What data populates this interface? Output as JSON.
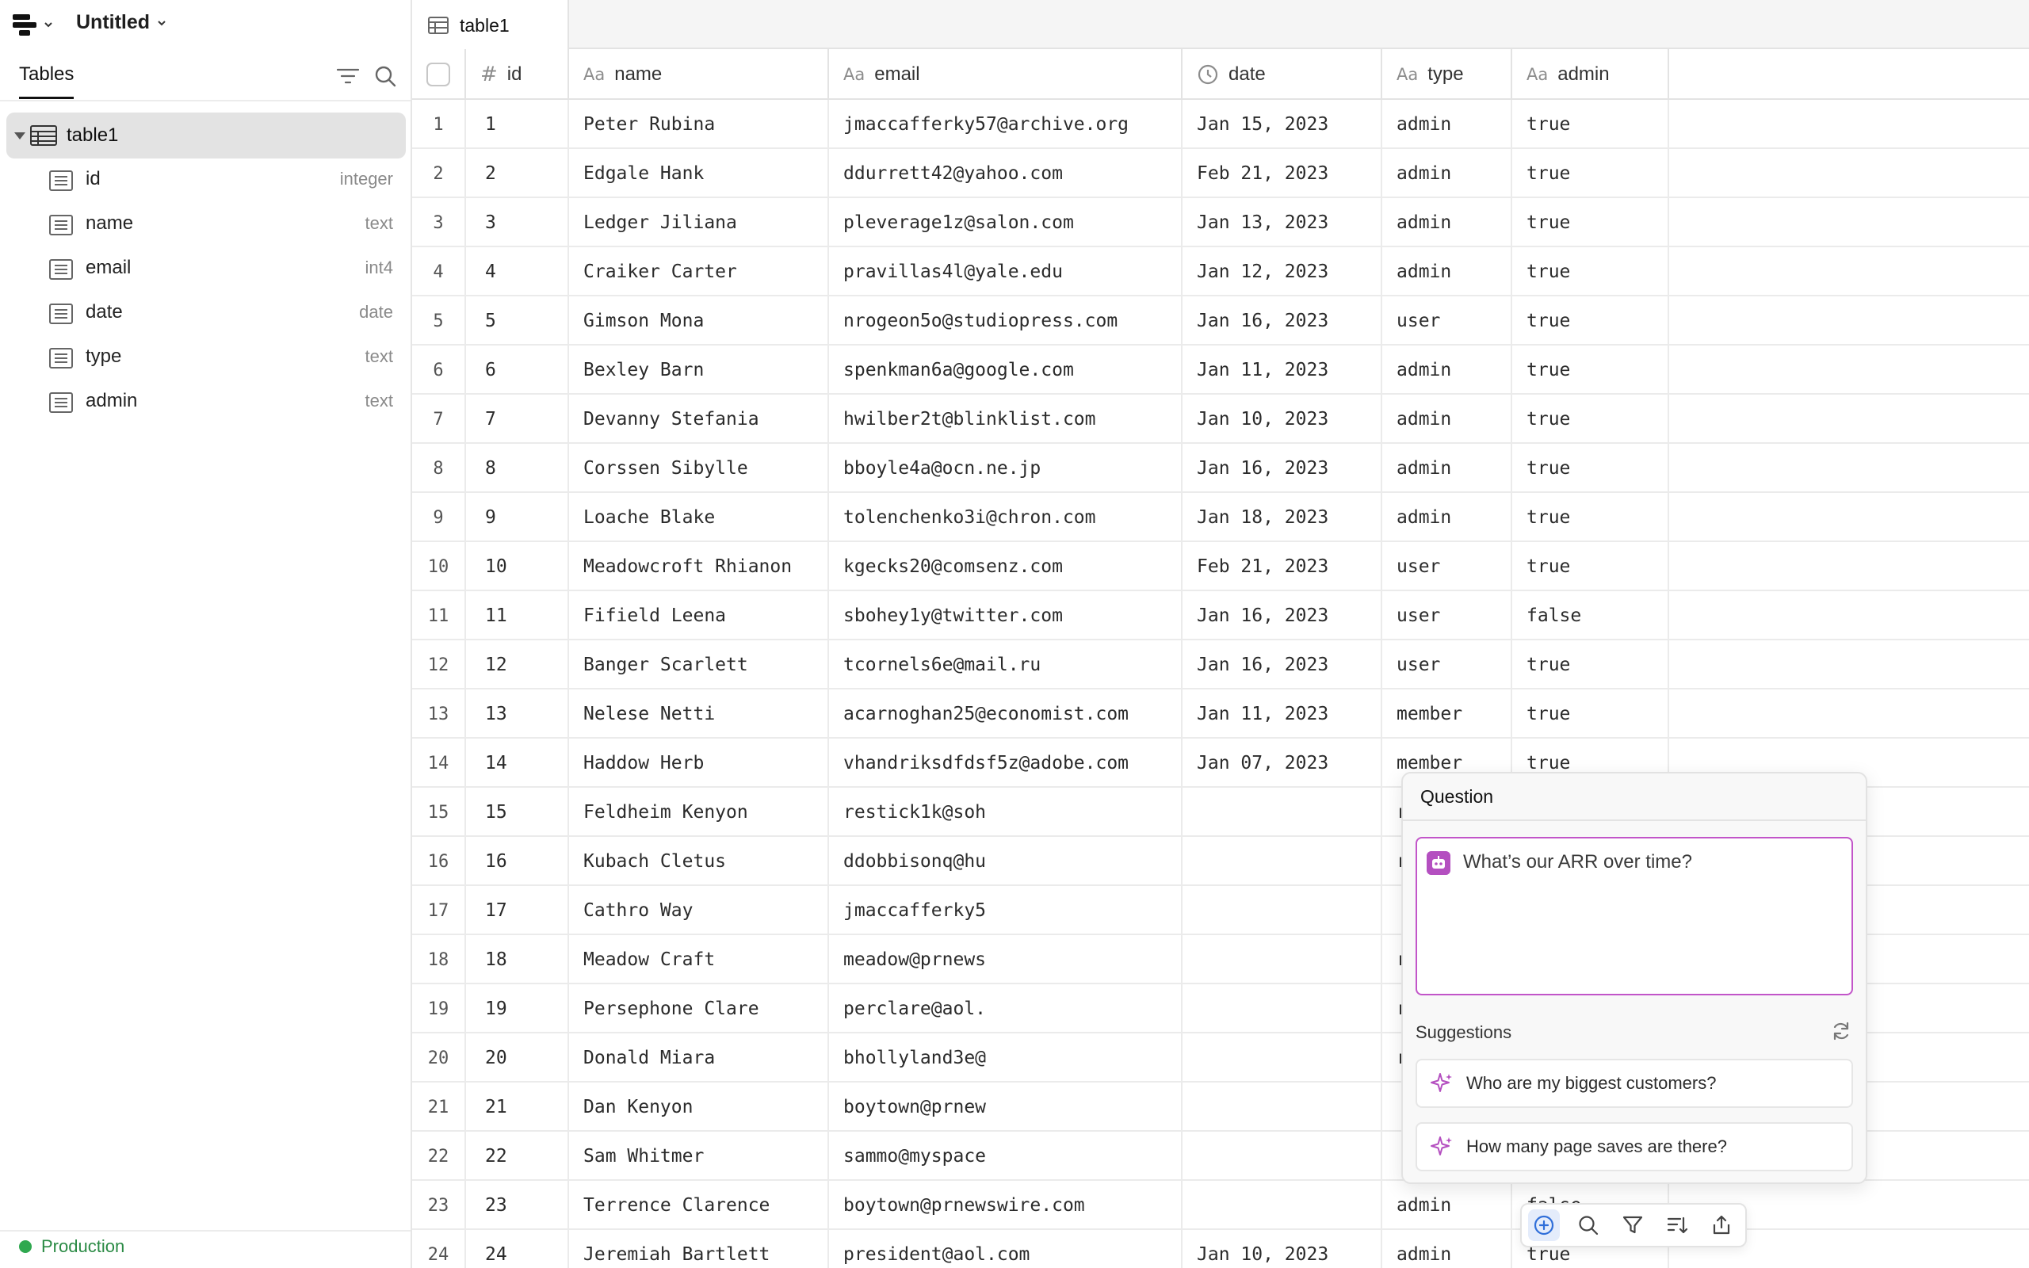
{
  "app": {
    "doc_title": "Untitled",
    "environment": "Production"
  },
  "sidebar": {
    "tab": "Tables",
    "table": {
      "name": "table1"
    },
    "fields": [
      {
        "name": "id",
        "type": "integer"
      },
      {
        "name": "name",
        "type": "text"
      },
      {
        "name": "email",
        "type": "int4"
      },
      {
        "name": "date",
        "type": "date"
      },
      {
        "name": "type",
        "type": "text"
      },
      {
        "name": "admin",
        "type": "text"
      }
    ]
  },
  "main": {
    "tab": "table1",
    "columns": [
      {
        "key": "id",
        "label": "id",
        "icon": "#"
      },
      {
        "key": "name",
        "label": "name",
        "icon": "Aa"
      },
      {
        "key": "email",
        "label": "email",
        "icon": "Aa"
      },
      {
        "key": "date",
        "label": "date",
        "icon": "clock"
      },
      {
        "key": "type",
        "label": "type",
        "icon": "Aa"
      },
      {
        "key": "admin",
        "label": "admin",
        "icon": "Aa"
      }
    ],
    "rows": [
      {
        "n": "1",
        "id": "1",
        "name": "Peter Rubina",
        "email": "jmaccafferky57@archive.org",
        "date": "Jan 15, 2023",
        "type": "admin",
        "admin": "true"
      },
      {
        "n": "2",
        "id": "2",
        "name": "Edgale Hank",
        "email": "ddurrett42@yahoo.com",
        "date": "Feb 21, 2023",
        "type": "admin",
        "admin": "true"
      },
      {
        "n": "3",
        "id": "3",
        "name": "Ledger Jiliana",
        "email": "pleverage1z@salon.com",
        "date": "Jan 13, 2023",
        "type": "admin",
        "admin": "true"
      },
      {
        "n": "4",
        "id": "4",
        "name": "Craiker Carter",
        "email": "pravillas4l@yale.edu",
        "date": "Jan 12, 2023",
        "type": "admin",
        "admin": "true"
      },
      {
        "n": "5",
        "id": "5",
        "name": "Gimson Mona",
        "email": "nrogeon5o@studiopress.com",
        "date": "Jan 16, 2023",
        "type": "user",
        "admin": "true"
      },
      {
        "n": "6",
        "id": "6",
        "name": "Bexley Barn",
        "email": "spenkman6a@google.com",
        "date": "Jan 11, 2023",
        "type": "admin",
        "admin": "true"
      },
      {
        "n": "7",
        "id": "7",
        "name": "Devanny Stefania",
        "email": "hwilber2t@blinklist.com",
        "date": "Jan 10, 2023",
        "type": "admin",
        "admin": "true"
      },
      {
        "n": "8",
        "id": "8",
        "name": "Corssen Sibylle",
        "email": "bboyle4a@ocn.ne.jp",
        "date": "Jan 16, 2023",
        "type": "admin",
        "admin": "true"
      },
      {
        "n": "9",
        "id": "9",
        "name": "Loache Blake",
        "email": "tolenchenko3i@chron.com",
        "date": "Jan 18, 2023",
        "type": "admin",
        "admin": "true"
      },
      {
        "n": "10",
        "id": "10",
        "name": "Meadowcroft Rhianon",
        "email": "kgecks20@comsenz.com",
        "date": "Feb 21, 2023",
        "type": "user",
        "admin": "true"
      },
      {
        "n": "11",
        "id": "11",
        "name": "Fifield Leena",
        "email": "sbohey1y@twitter.com",
        "date": "Jan 16, 2023",
        "type": "user",
        "admin": "false"
      },
      {
        "n": "12",
        "id": "12",
        "name": "Banger Scarlett",
        "email": "tcornels6e@mail.ru",
        "date": "Jan 16, 2023",
        "type": "user",
        "admin": "true"
      },
      {
        "n": "13",
        "id": "13",
        "name": "Nelese Netti",
        "email": "acarnoghan25@economist.com",
        "date": "Jan 11, 2023",
        "type": "member",
        "admin": "true"
      },
      {
        "n": "14",
        "id": "14",
        "name": "Haddow Herb",
        "email": "vhandriksdfdsf5z@adobe.com",
        "date": "Jan 07, 2023",
        "type": "member",
        "admin": "true"
      },
      {
        "n": "15",
        "id": "15",
        "name": "Feldheim Kenyon",
        "email": "restick1k@soh",
        "date": "",
        "type": "r",
        "admin": "true"
      },
      {
        "n": "16",
        "id": "16",
        "name": "Kubach Cletus",
        "email": "ddobbisonq@hu",
        "date": "",
        "type": "r",
        "admin": "true"
      },
      {
        "n": "17",
        "id": "17",
        "name": "Cathro Way",
        "email": "jmaccafferky5",
        "date": "",
        "type": "",
        "admin": "false"
      },
      {
        "n": "18",
        "id": "18",
        "name": "Meadow Craft",
        "email": "meadow@prnews",
        "date": "",
        "type": "r",
        "admin": "true"
      },
      {
        "n": "19",
        "id": "19",
        "name": "Persephone Clare",
        "email": "perclare@aol.",
        "date": "",
        "type": "r",
        "admin": "false"
      },
      {
        "n": "20",
        "id": "20",
        "name": "Donald Miara",
        "email": "bhollyland3e@",
        "date": "",
        "type": "r",
        "admin": "true"
      },
      {
        "n": "21",
        "id": "21",
        "name": "Dan Kenyon",
        "email": "boytown@prnew",
        "date": "",
        "type": "",
        "admin": "true"
      },
      {
        "n": "22",
        "id": "22",
        "name": "Sam Whitmer",
        "email": "sammo@myspace",
        "date": "",
        "type": "",
        "admin": "true"
      },
      {
        "n": "23",
        "id": "23",
        "name": "Terrence Clarence",
        "email": "boytown@prnewswire.com",
        "date": "",
        "type": "admin",
        "admin": "false"
      },
      {
        "n": "24",
        "id": "24",
        "name": "Jeremiah Bartlett",
        "email": "president@aol.com",
        "date": "Jan 10, 2023",
        "type": "admin",
        "admin": "true"
      }
    ]
  },
  "question_panel": {
    "title": "Question",
    "input_text": "What’s our ARR over time?",
    "suggestions_label": "Suggestions",
    "suggestions": [
      "Who are my biggest customers?",
      "How many page saves are there?"
    ]
  },
  "colors": {
    "accent_purple": "#b44fc0",
    "focus_border": "#c255c9",
    "environment_green": "#2fa84f",
    "toolbar_active": "#e4ecfb"
  }
}
